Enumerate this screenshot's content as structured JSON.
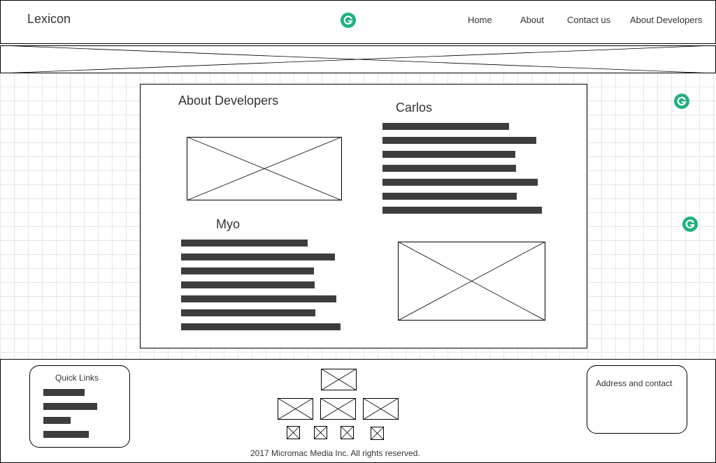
{
  "header": {
    "logo": "Lexicon",
    "nav": [
      {
        "label": "Home"
      },
      {
        "label": "About"
      },
      {
        "label": "Contact us"
      },
      {
        "label": "About Developers"
      }
    ]
  },
  "main": {
    "section_title": "About Developers",
    "developers": [
      {
        "name": "Carlos",
        "text_lines": 7
      },
      {
        "name": "Myo",
        "text_lines": 7
      }
    ]
  },
  "footer": {
    "quick_links": {
      "title": "Quick Links",
      "link_count": 4
    },
    "address": {
      "title": "Address and contact"
    },
    "copyright": "2017 Micromac Media Inc. All rights reserved."
  },
  "colors": {
    "grammarly_badge": "#1fb17e",
    "text_bar": "#3d3d3d",
    "grid_line": "#e6e6e6"
  },
  "icons": [
    "grammarly-icon",
    "image-placeholder-icon"
  ]
}
